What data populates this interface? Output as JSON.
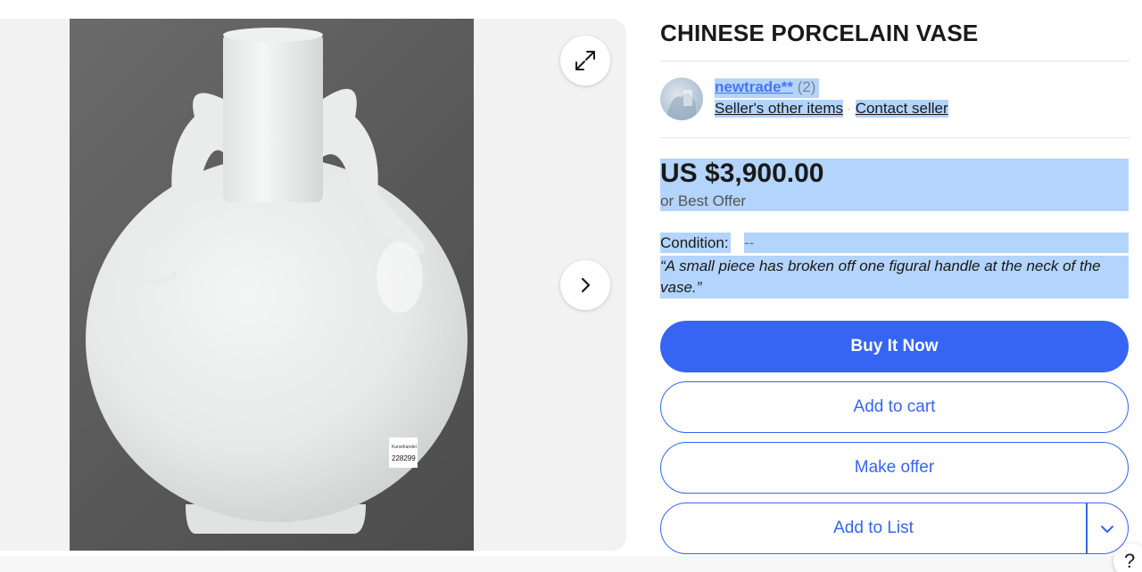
{
  "gallery": {
    "image_alt": "Chinese porcelain moon flask vase with dragon handles",
    "label_lines": [
      "Kunsthandel",
      "228299"
    ],
    "expand_icon": "expand-arrows-icon",
    "next_icon": "chevron-right-icon"
  },
  "listing": {
    "title": "CHINESE PORCELAIN VASE"
  },
  "seller": {
    "name": "newtrade**",
    "feedback_count": "(2)",
    "other_items_label": "Seller's other items",
    "separator": "·",
    "contact_label": "Contact seller"
  },
  "price": {
    "amount": "US $3,900.00",
    "best_offer": "or Best Offer"
  },
  "condition": {
    "label": "Condition:",
    "value": "--",
    "note": "“A small piece has broken off one figural handle at the neck of the vase.”"
  },
  "actions": {
    "buy_now": "Buy It Now",
    "add_to_cart": "Add to cart",
    "make_offer": "Make offer",
    "add_to_list": "Add to List",
    "list_dropdown_icon": "chevron-down-icon"
  },
  "help": {
    "label": "?"
  },
  "colors": {
    "primary": "#3665f3",
    "selection": "#b3d4fc",
    "text": "#191919"
  }
}
